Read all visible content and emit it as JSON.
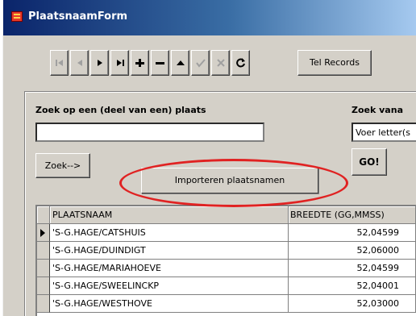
{
  "window": {
    "title": "PlaatsnaamForm"
  },
  "toolbar": {
    "nav_buttons": [
      {
        "name": "first-record-icon",
        "enabled": false
      },
      {
        "name": "prior-record-icon",
        "enabled": false
      },
      {
        "name": "next-record-icon",
        "enabled": true
      },
      {
        "name": "last-record-icon",
        "enabled": true
      },
      {
        "name": "insert-record-icon",
        "enabled": true
      },
      {
        "name": "delete-record-icon",
        "enabled": true
      },
      {
        "name": "edit-record-icon",
        "enabled": true
      },
      {
        "name": "post-record-icon",
        "enabled": false
      },
      {
        "name": "cancel-record-icon",
        "enabled": false
      },
      {
        "name": "refresh-icon",
        "enabled": true
      }
    ],
    "tel_records_label": "Tel Records"
  },
  "search": {
    "label": "Zoek op een (deel van een) plaats",
    "value": "",
    "button_label": "Zoek-->"
  },
  "search_letter": {
    "label": "Zoek vana",
    "value": "Voer letter(s",
    "go_label": "GO!"
  },
  "popup_menu": {
    "item_label": "Importeren plaatsnamen"
  },
  "grid": {
    "columns": [
      "PLAATSNAAM",
      "BREEDTE (GG,MMSS)"
    ],
    "rows": [
      {
        "naam": "'S-G.HAGE/CATSHUIS",
        "breedte": "52,04599",
        "current": true
      },
      {
        "naam": "'S-G.HAGE/DUINDIGT",
        "breedte": "52,06000",
        "current": false
      },
      {
        "naam": "'S-G.HAGE/MARIAHOEVE",
        "breedte": "52,04599",
        "current": false
      },
      {
        "naam": "'S-G.HAGE/SWEELINCKP",
        "breedte": "52,04001",
        "current": false
      },
      {
        "naam": "'S-G.HAGE/WESTHOVE",
        "breedte": "52,03000",
        "current": false
      }
    ]
  },
  "colors": {
    "face": "#d4d0c8",
    "title_start": "#0a246a",
    "title_end": "#a6caf0",
    "highlight": "#e02222",
    "disabled_glyph": "#a0a0a0"
  }
}
